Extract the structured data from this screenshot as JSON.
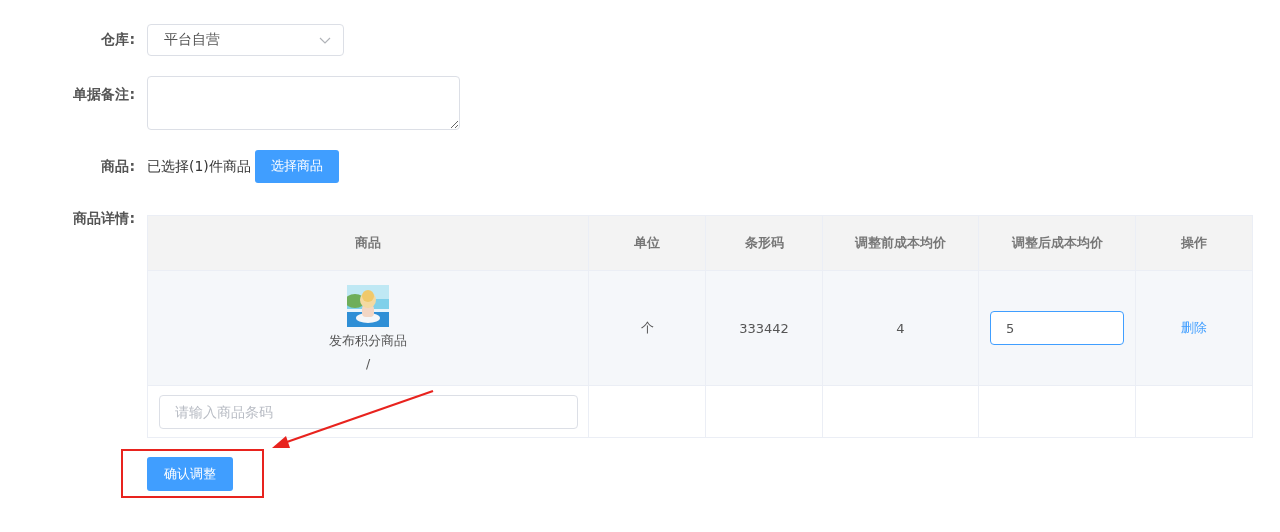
{
  "form": {
    "warehouse": {
      "label": "仓库:",
      "value": "平台自营"
    },
    "remark": {
      "label": "单据备注:"
    },
    "goods": {
      "label": "商品:",
      "summary": "已选择(1)件商品",
      "button": "选择商品"
    },
    "details_label": "商品详情:"
  },
  "table": {
    "columns": [
      "商品",
      "单位",
      "条形码",
      "调整前成本均价",
      "调整后成本均价",
      "操作"
    ],
    "rows": [
      {
        "kind": "product",
        "name": "发布积分商品",
        "spec": "/",
        "unit": "个",
        "barcode": "333442",
        "cost_before": "4",
        "cost_after": "5",
        "action": "删除"
      }
    ],
    "barcode_input": {
      "placeholder": "请输入商品条码"
    }
  },
  "submit_button": "确认调整"
}
